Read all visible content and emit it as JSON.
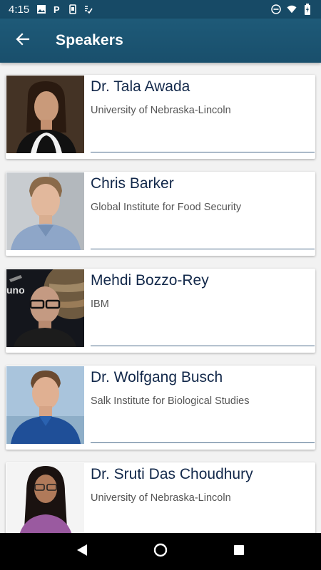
{
  "status_bar": {
    "time": "4:15"
  },
  "app_bar": {
    "title": "Speakers"
  },
  "speakers": [
    {
      "name": "Dr. Tala Awada",
      "org": "University of Nebraska-Lincoln"
    },
    {
      "name": "Chris Barker",
      "org": "Global Institute for Food Security"
    },
    {
      "name": "Mehdi Bozzo-Rey",
      "org": "IBM"
    },
    {
      "name": "Dr. Wolfgang Busch",
      "org": "Salk Institute for Biological Studies"
    },
    {
      "name": "Dr. Sruti Das Choudhury",
      "org": "University of Nebraska-Lincoln"
    }
  ],
  "colors": {
    "app_bar": "#1e5a78",
    "status_bar": "#174a66",
    "name_text": "#12284a"
  }
}
